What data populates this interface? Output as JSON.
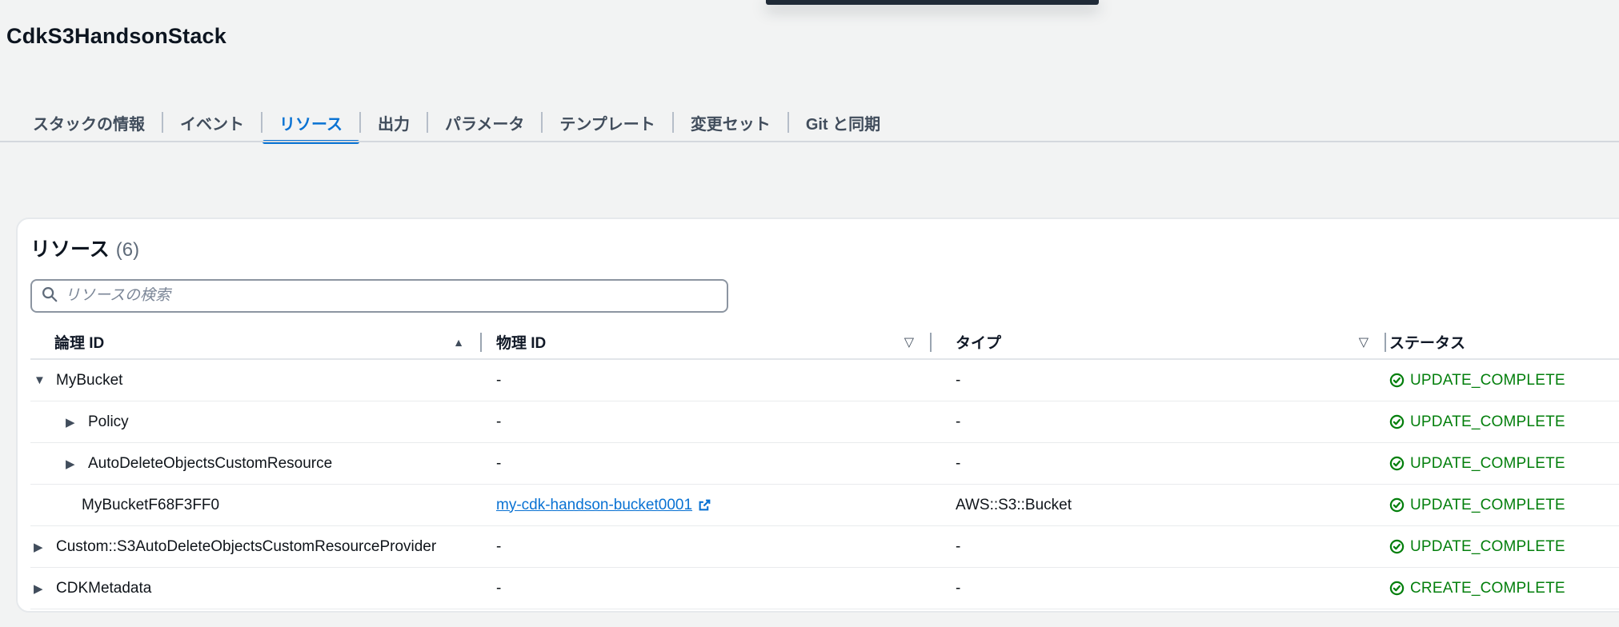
{
  "page": {
    "title": "CdkS3HandsonStack"
  },
  "colors": {
    "accent": "#0972d3",
    "success": "#037f0c",
    "overlay_bar": "#1f2a37"
  },
  "tabs": [
    {
      "label": "スタックの情報",
      "active": false
    },
    {
      "label": "イベント",
      "active": false
    },
    {
      "label": "リソース",
      "active": true
    },
    {
      "label": "出力",
      "active": false
    },
    {
      "label": "パラメータ",
      "active": false
    },
    {
      "label": "テンプレート",
      "active": false
    },
    {
      "label": "変更セット",
      "active": false
    },
    {
      "label": "Git と同期",
      "active": false
    }
  ],
  "panel": {
    "heading": "リソース",
    "count": "(6)",
    "search": {
      "placeholder": "リソースの検索"
    },
    "table": {
      "columns": [
        {
          "label": "論理 ID",
          "sort": "ascending"
        },
        {
          "label": "物理 ID",
          "filter": true
        },
        {
          "label": "タイプ",
          "filter": true
        },
        {
          "label": "ステータス"
        }
      ],
      "rows": [
        {
          "logical_id": "MyBucket",
          "level": 1,
          "expander": "expanded",
          "physical_id": "-",
          "physical_id_link": false,
          "type": "-",
          "status": "UPDATE_COMPLETE"
        },
        {
          "logical_id": "Policy",
          "level": 2,
          "expander": "collapsed",
          "physical_id": "-",
          "physical_id_link": false,
          "type": "-",
          "status": "UPDATE_COMPLETE"
        },
        {
          "logical_id": "AutoDeleteObjectsCustomResource",
          "level": 2,
          "expander": "collapsed",
          "physical_id": "-",
          "physical_id_link": false,
          "type": "-",
          "status": "UPDATE_COMPLETE"
        },
        {
          "logical_id": "MyBucketF68F3FF0",
          "level": 2,
          "expander": "none",
          "physical_id": "my-cdk-handson-bucket0001",
          "physical_id_link": true,
          "type": "AWS::S3::Bucket",
          "status": "UPDATE_COMPLETE"
        },
        {
          "logical_id": "Custom::S3AutoDeleteObjectsCustomResourceProvider",
          "level": 1,
          "expander": "collapsed",
          "physical_id": "-",
          "physical_id_link": false,
          "type": "-",
          "status": "UPDATE_COMPLETE"
        },
        {
          "logical_id": "CDKMetadata",
          "level": 1,
          "expander": "collapsed",
          "physical_id": "-",
          "physical_id_link": false,
          "type": "-",
          "status": "CREATE_COMPLETE"
        }
      ]
    }
  }
}
